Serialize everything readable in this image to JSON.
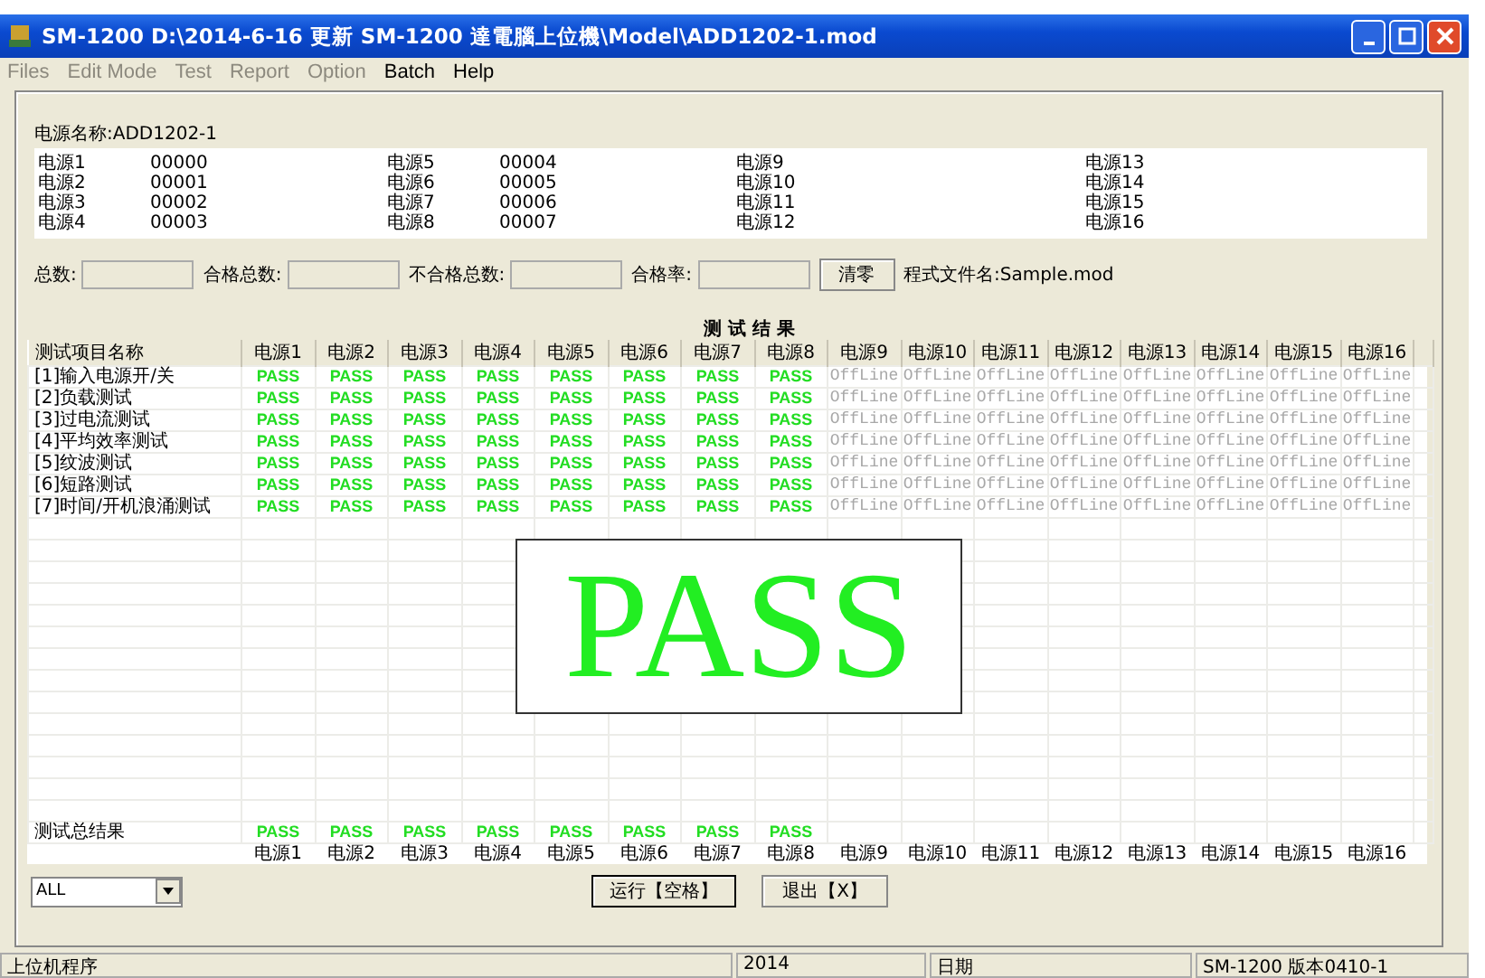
{
  "window": {
    "title": "SM-1200   D:\\2014-6-16 更新 SM-1200 達電腦上位機\\Model\\ADD1202-1.mod"
  },
  "menu": [
    {
      "label": "Files",
      "disabled": true
    },
    {
      "label": "Edit Mode",
      "disabled": true
    },
    {
      "label": "Test",
      "disabled": true
    },
    {
      "label": "Report",
      "disabled": true
    },
    {
      "label": "Option",
      "disabled": true
    },
    {
      "label": "Batch",
      "disabled": false
    },
    {
      "label": "Help",
      "disabled": false
    }
  ],
  "model_name": "电源名称:ADD1202-1",
  "channels": [
    {
      "label": "电源1",
      "code": "00000"
    },
    {
      "label": "电源2",
      "code": "00001"
    },
    {
      "label": "电源3",
      "code": "00002"
    },
    {
      "label": "电源4",
      "code": "00003"
    },
    {
      "label": "电源5",
      "code": "00004"
    },
    {
      "label": "电源6",
      "code": "00005"
    },
    {
      "label": "电源7",
      "code": "00006"
    },
    {
      "label": "电源8",
      "code": "00007"
    },
    {
      "label": "电源9"
    },
    {
      "label": "电源10"
    },
    {
      "label": "电源11"
    },
    {
      "label": "电源12"
    },
    {
      "label": "电源13"
    },
    {
      "label": "电源14"
    },
    {
      "label": "电源15"
    },
    {
      "label": "电源16"
    }
  ],
  "counters": [
    {
      "label": "总数:"
    },
    {
      "label": "合格总数:"
    },
    {
      "label": "不合格总数:"
    },
    {
      "label": "合格率:"
    }
  ],
  "clear_button": "清零",
  "program_file": "程式文件名:Sample.mod",
  "results_title": "测 试 结 果",
  "table": {
    "columns": [
      "测试项目名称",
      "电源1",
      "电源2",
      "电源3",
      "电源4",
      "电源5",
      "电源6",
      "电源7",
      "电源8",
      "电源9",
      "电源10",
      "电源11",
      "电源12",
      "电源13",
      "电源14",
      "电源15",
      "电源16"
    ],
    "rows": [
      {
        "cells": [
          {
            "text": "[1]输入电源开/关",
            "kind": "name"
          },
          {
            "text": "PASS",
            "kind": "pass"
          },
          {
            "text": "PASS",
            "kind": "pass"
          },
          {
            "text": "PASS",
            "kind": "pass"
          },
          {
            "text": "PASS",
            "kind": "pass"
          },
          {
            "text": "PASS",
            "kind": "pass"
          },
          {
            "text": "PASS",
            "kind": "pass"
          },
          {
            "text": "PASS",
            "kind": "pass"
          },
          {
            "text": "PASS",
            "kind": "pass"
          },
          {
            "text": "OffLine",
            "kind": "offline"
          },
          {
            "text": "OffLine",
            "kind": "offline"
          },
          {
            "text": "OffLine",
            "kind": "offline"
          },
          {
            "text": "OffLine",
            "kind": "offline"
          },
          {
            "text": "OffLine",
            "kind": "offline"
          },
          {
            "text": "OffLine",
            "kind": "offline"
          },
          {
            "text": "OffLine",
            "kind": "offline"
          },
          {
            "text": "OffLine",
            "kind": "offline"
          }
        ]
      },
      {
        "cells": [
          {
            "text": "[2]负载测试",
            "kind": "name"
          },
          {
            "text": "PASS",
            "kind": "pass"
          },
          {
            "text": "PASS",
            "kind": "pass"
          },
          {
            "text": "PASS",
            "kind": "pass"
          },
          {
            "text": "PASS",
            "kind": "pass"
          },
          {
            "text": "PASS",
            "kind": "pass"
          },
          {
            "text": "PASS",
            "kind": "pass"
          },
          {
            "text": "PASS",
            "kind": "pass"
          },
          {
            "text": "PASS",
            "kind": "pass"
          },
          {
            "text": "OffLine",
            "kind": "offline"
          },
          {
            "text": "OffLine",
            "kind": "offline"
          },
          {
            "text": "OffLine",
            "kind": "offline"
          },
          {
            "text": "OffLine",
            "kind": "offline"
          },
          {
            "text": "OffLine",
            "kind": "offline"
          },
          {
            "text": "OffLine",
            "kind": "offline"
          },
          {
            "text": "OffLine",
            "kind": "offline"
          },
          {
            "text": "OffLine",
            "kind": "offline"
          }
        ]
      },
      {
        "cells": [
          {
            "text": "[3]过电流测试",
            "kind": "name"
          },
          {
            "text": "PASS",
            "kind": "pass"
          },
          {
            "text": "PASS",
            "kind": "pass"
          },
          {
            "text": "PASS",
            "kind": "pass"
          },
          {
            "text": "PASS",
            "kind": "pass"
          },
          {
            "text": "PASS",
            "kind": "pass"
          },
          {
            "text": "PASS",
            "kind": "pass"
          },
          {
            "text": "PASS",
            "kind": "pass"
          },
          {
            "text": "PASS",
            "kind": "pass"
          },
          {
            "text": "OffLine",
            "kind": "offline"
          },
          {
            "text": "OffLine",
            "kind": "offline"
          },
          {
            "text": "OffLine",
            "kind": "offline"
          },
          {
            "text": "OffLine",
            "kind": "offline"
          },
          {
            "text": "OffLine",
            "kind": "offline"
          },
          {
            "text": "OffLine",
            "kind": "offline"
          },
          {
            "text": "OffLine",
            "kind": "offline"
          },
          {
            "text": "OffLine",
            "kind": "offline"
          }
        ]
      },
      {
        "cells": [
          {
            "text": "[4]平均效率测试",
            "kind": "name"
          },
          {
            "text": "PASS",
            "kind": "pass"
          },
          {
            "text": "PASS",
            "kind": "pass"
          },
          {
            "text": "PASS",
            "kind": "pass"
          },
          {
            "text": "PASS",
            "kind": "pass"
          },
          {
            "text": "PASS",
            "kind": "pass"
          },
          {
            "text": "PASS",
            "kind": "pass"
          },
          {
            "text": "PASS",
            "kind": "pass"
          },
          {
            "text": "PASS",
            "kind": "pass"
          },
          {
            "text": "OffLine",
            "kind": "offline"
          },
          {
            "text": "OffLine",
            "kind": "offline"
          },
          {
            "text": "OffLine",
            "kind": "offline"
          },
          {
            "text": "OffLine",
            "kind": "offline"
          },
          {
            "text": "OffLine",
            "kind": "offline"
          },
          {
            "text": "OffLine",
            "kind": "offline"
          },
          {
            "text": "OffLine",
            "kind": "offline"
          },
          {
            "text": "OffLine",
            "kind": "offline"
          }
        ]
      },
      {
        "cells": [
          {
            "text": "[5]纹波测试",
            "kind": "name"
          },
          {
            "text": "PASS",
            "kind": "pass"
          },
          {
            "text": "PASS",
            "kind": "pass"
          },
          {
            "text": "PASS",
            "kind": "pass"
          },
          {
            "text": "PASS",
            "kind": "pass"
          },
          {
            "text": "PASS",
            "kind": "pass"
          },
          {
            "text": "PASS",
            "kind": "pass"
          },
          {
            "text": "PASS",
            "kind": "pass"
          },
          {
            "text": "PASS",
            "kind": "pass"
          },
          {
            "text": "OffLine",
            "kind": "offline"
          },
          {
            "text": "OffLine",
            "kind": "offline"
          },
          {
            "text": "OffLine",
            "kind": "offline"
          },
          {
            "text": "OffLine",
            "kind": "offline"
          },
          {
            "text": "OffLine",
            "kind": "offline"
          },
          {
            "text": "OffLine",
            "kind": "offline"
          },
          {
            "text": "OffLine",
            "kind": "offline"
          },
          {
            "text": "OffLine",
            "kind": "offline"
          }
        ]
      },
      {
        "cells": [
          {
            "text": "[6]短路测试",
            "kind": "name"
          },
          {
            "text": "PASS",
            "kind": "pass"
          },
          {
            "text": "PASS",
            "kind": "pass"
          },
          {
            "text": "PASS",
            "kind": "pass"
          },
          {
            "text": "PASS",
            "kind": "pass"
          },
          {
            "text": "PASS",
            "kind": "pass"
          },
          {
            "text": "PASS",
            "kind": "pass"
          },
          {
            "text": "PASS",
            "kind": "pass"
          },
          {
            "text": "PASS",
            "kind": "pass"
          },
          {
            "text": "OffLine",
            "kind": "offline"
          },
          {
            "text": "OffLine",
            "kind": "offline"
          },
          {
            "text": "OffLine",
            "kind": "offline"
          },
          {
            "text": "OffLine",
            "kind": "offline"
          },
          {
            "text": "OffLine",
            "kind": "offline"
          },
          {
            "text": "OffLine",
            "kind": "offline"
          },
          {
            "text": "OffLine",
            "kind": "offline"
          },
          {
            "text": "OffLine",
            "kind": "offline"
          }
        ]
      },
      {
        "cells": [
          {
            "text": "[7]时间/开机浪涌测试",
            "kind": "name"
          },
          {
            "text": "PASS",
            "kind": "pass"
          },
          {
            "text": "PASS",
            "kind": "pass"
          },
          {
            "text": "PASS",
            "kind": "pass"
          },
          {
            "text": "PASS",
            "kind": "pass"
          },
          {
            "text": "PASS",
            "kind": "pass"
          },
          {
            "text": "PASS",
            "kind": "pass"
          },
          {
            "text": "PASS",
            "kind": "pass"
          },
          {
            "text": "PASS",
            "kind": "pass"
          },
          {
            "text": "OffLine",
            "kind": "offline"
          },
          {
            "text": "OffLine",
            "kind": "offline"
          },
          {
            "text": "OffLine",
            "kind": "offline"
          },
          {
            "text": "OffLine",
            "kind": "offline"
          },
          {
            "text": "OffLine",
            "kind": "offline"
          },
          {
            "text": "OffLine",
            "kind": "offline"
          },
          {
            "text": "OffLine",
            "kind": "offline"
          },
          {
            "text": "OffLine",
            "kind": "offline"
          }
        ]
      }
    ],
    "total_row": {
      "cells": [
        {
          "text": "测试总结果",
          "kind": "name"
        },
        {
          "text": "PASS",
          "kind": "pass"
        },
        {
          "text": "PASS",
          "kind": "pass"
        },
        {
          "text": "PASS",
          "kind": "pass"
        },
        {
          "text": "PASS",
          "kind": "pass"
        },
        {
          "text": "PASS",
          "kind": "pass"
        },
        {
          "text": "PASS",
          "kind": "pass"
        },
        {
          "text": "PASS",
          "kind": "pass"
        },
        {
          "text": "PASS",
          "kind": "pass"
        }
      ]
    },
    "footer_labels": [
      "电源1",
      "电源2",
      "电源3",
      "电源4",
      "电源5",
      "电源6",
      "电源7",
      "电源8",
      "电源9",
      "电源10",
      "电源11",
      "电源12",
      "电源13",
      "电源14",
      "电源15",
      "电源16"
    ]
  },
  "big_result": {
    "text": "PASS",
    "kind": "pass"
  },
  "filter": {
    "value": "ALL"
  },
  "buttons": [
    "运行【空格】",
    "退出【X】"
  ],
  "status_bar": [
    "上位机程序",
    "2014",
    "日期",
    "SM-1200  版本0410-1"
  ]
}
